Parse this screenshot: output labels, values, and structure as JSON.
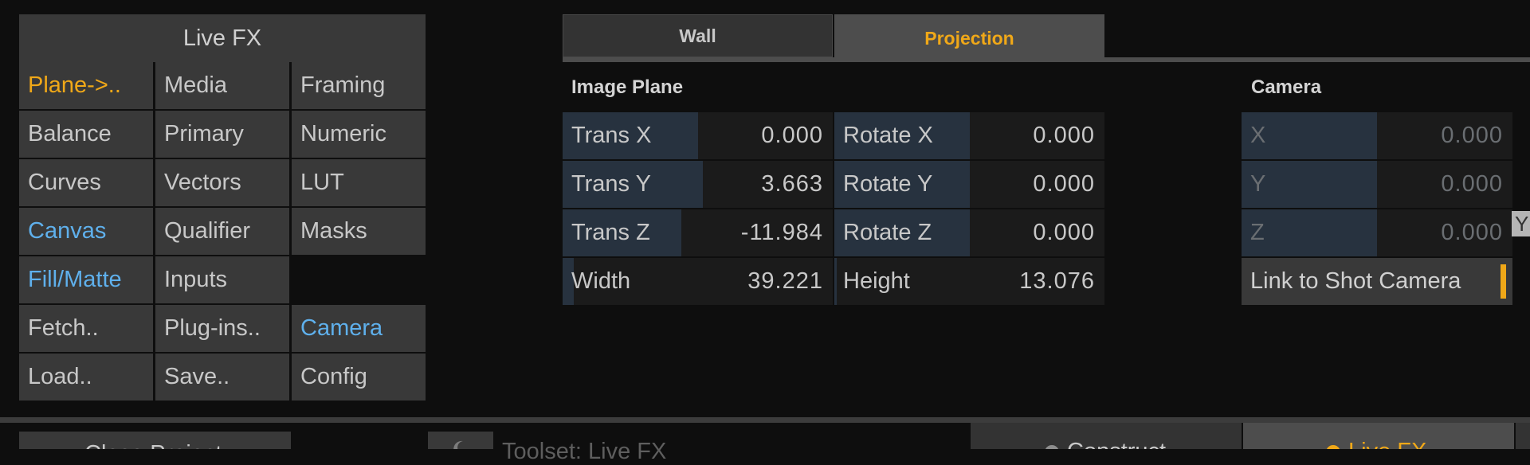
{
  "menu": {
    "title": "Live FX",
    "items": [
      {
        "label": "Plane->..",
        "color": "orange"
      },
      {
        "label": "Media",
        "color": "normal"
      },
      {
        "label": "Framing",
        "color": "normal"
      },
      {
        "label": "Balance",
        "color": "normal"
      },
      {
        "label": "Primary",
        "color": "normal"
      },
      {
        "label": "Numeric",
        "color": "normal"
      },
      {
        "label": "Curves",
        "color": "normal"
      },
      {
        "label": "Vectors",
        "color": "normal"
      },
      {
        "label": "LUT",
        "color": "normal"
      },
      {
        "label": "Canvas",
        "color": "blue"
      },
      {
        "label": "Qualifier",
        "color": "normal"
      },
      {
        "label": "Masks",
        "color": "normal"
      },
      {
        "label": "Fill/Matte",
        "color": "blue"
      },
      {
        "label": "Inputs",
        "color": "normal"
      },
      {
        "label": "",
        "color": "empty"
      },
      {
        "label": "Fetch..",
        "color": "normal"
      },
      {
        "label": "Plug-ins..",
        "color": "normal"
      },
      {
        "label": "Camera",
        "color": "blue"
      },
      {
        "label": "Load..",
        "color": "normal"
      },
      {
        "label": "Save..",
        "color": "normal"
      },
      {
        "label": "Config",
        "color": "normal"
      }
    ]
  },
  "tabs": [
    {
      "label": "Wall",
      "active": false
    },
    {
      "label": "Projection",
      "active": true
    }
  ],
  "image_plane": {
    "title": "Image Plane",
    "left": [
      {
        "label": "Trans X",
        "value": "0.000",
        "level": 0.5
      },
      {
        "label": "Trans Y",
        "value": "3.663",
        "level": 0.52
      },
      {
        "label": "Trans Z",
        "value": "-11.984",
        "level": 0.44
      },
      {
        "label": "Width",
        "value": "39.221",
        "level": 0.04
      }
    ],
    "right": [
      {
        "label": "Rotate X",
        "value": "0.000",
        "level": 0.5
      },
      {
        "label": "Rotate Y",
        "value": "0.000",
        "level": 0.5
      },
      {
        "label": "Rotate Z",
        "value": "0.000",
        "level": 0.5
      },
      {
        "label": "Height",
        "value": "13.076",
        "level": 0.01
      }
    ]
  },
  "camera": {
    "title": "Camera",
    "params": [
      {
        "label": "X",
        "value": "0.000",
        "level": 0.5
      },
      {
        "label": "Y",
        "value": "0.000",
        "level": 0.5
      },
      {
        "label": "Z",
        "value": "0.000",
        "level": 0.5
      }
    ],
    "link_label": "Link to Shot Camera",
    "edge_label": "Y"
  },
  "bottom": {
    "close_label": "Close Project",
    "toolset_label": "Toolset: Live FX",
    "construct_label": "Construct",
    "livefx_label": "Live FX"
  },
  "colors": {
    "accent_orange": "#f0a818",
    "accent_blue": "#5fb0ec",
    "panel": "#393939",
    "field": "#1b1b1b",
    "fill": "#27323f"
  }
}
